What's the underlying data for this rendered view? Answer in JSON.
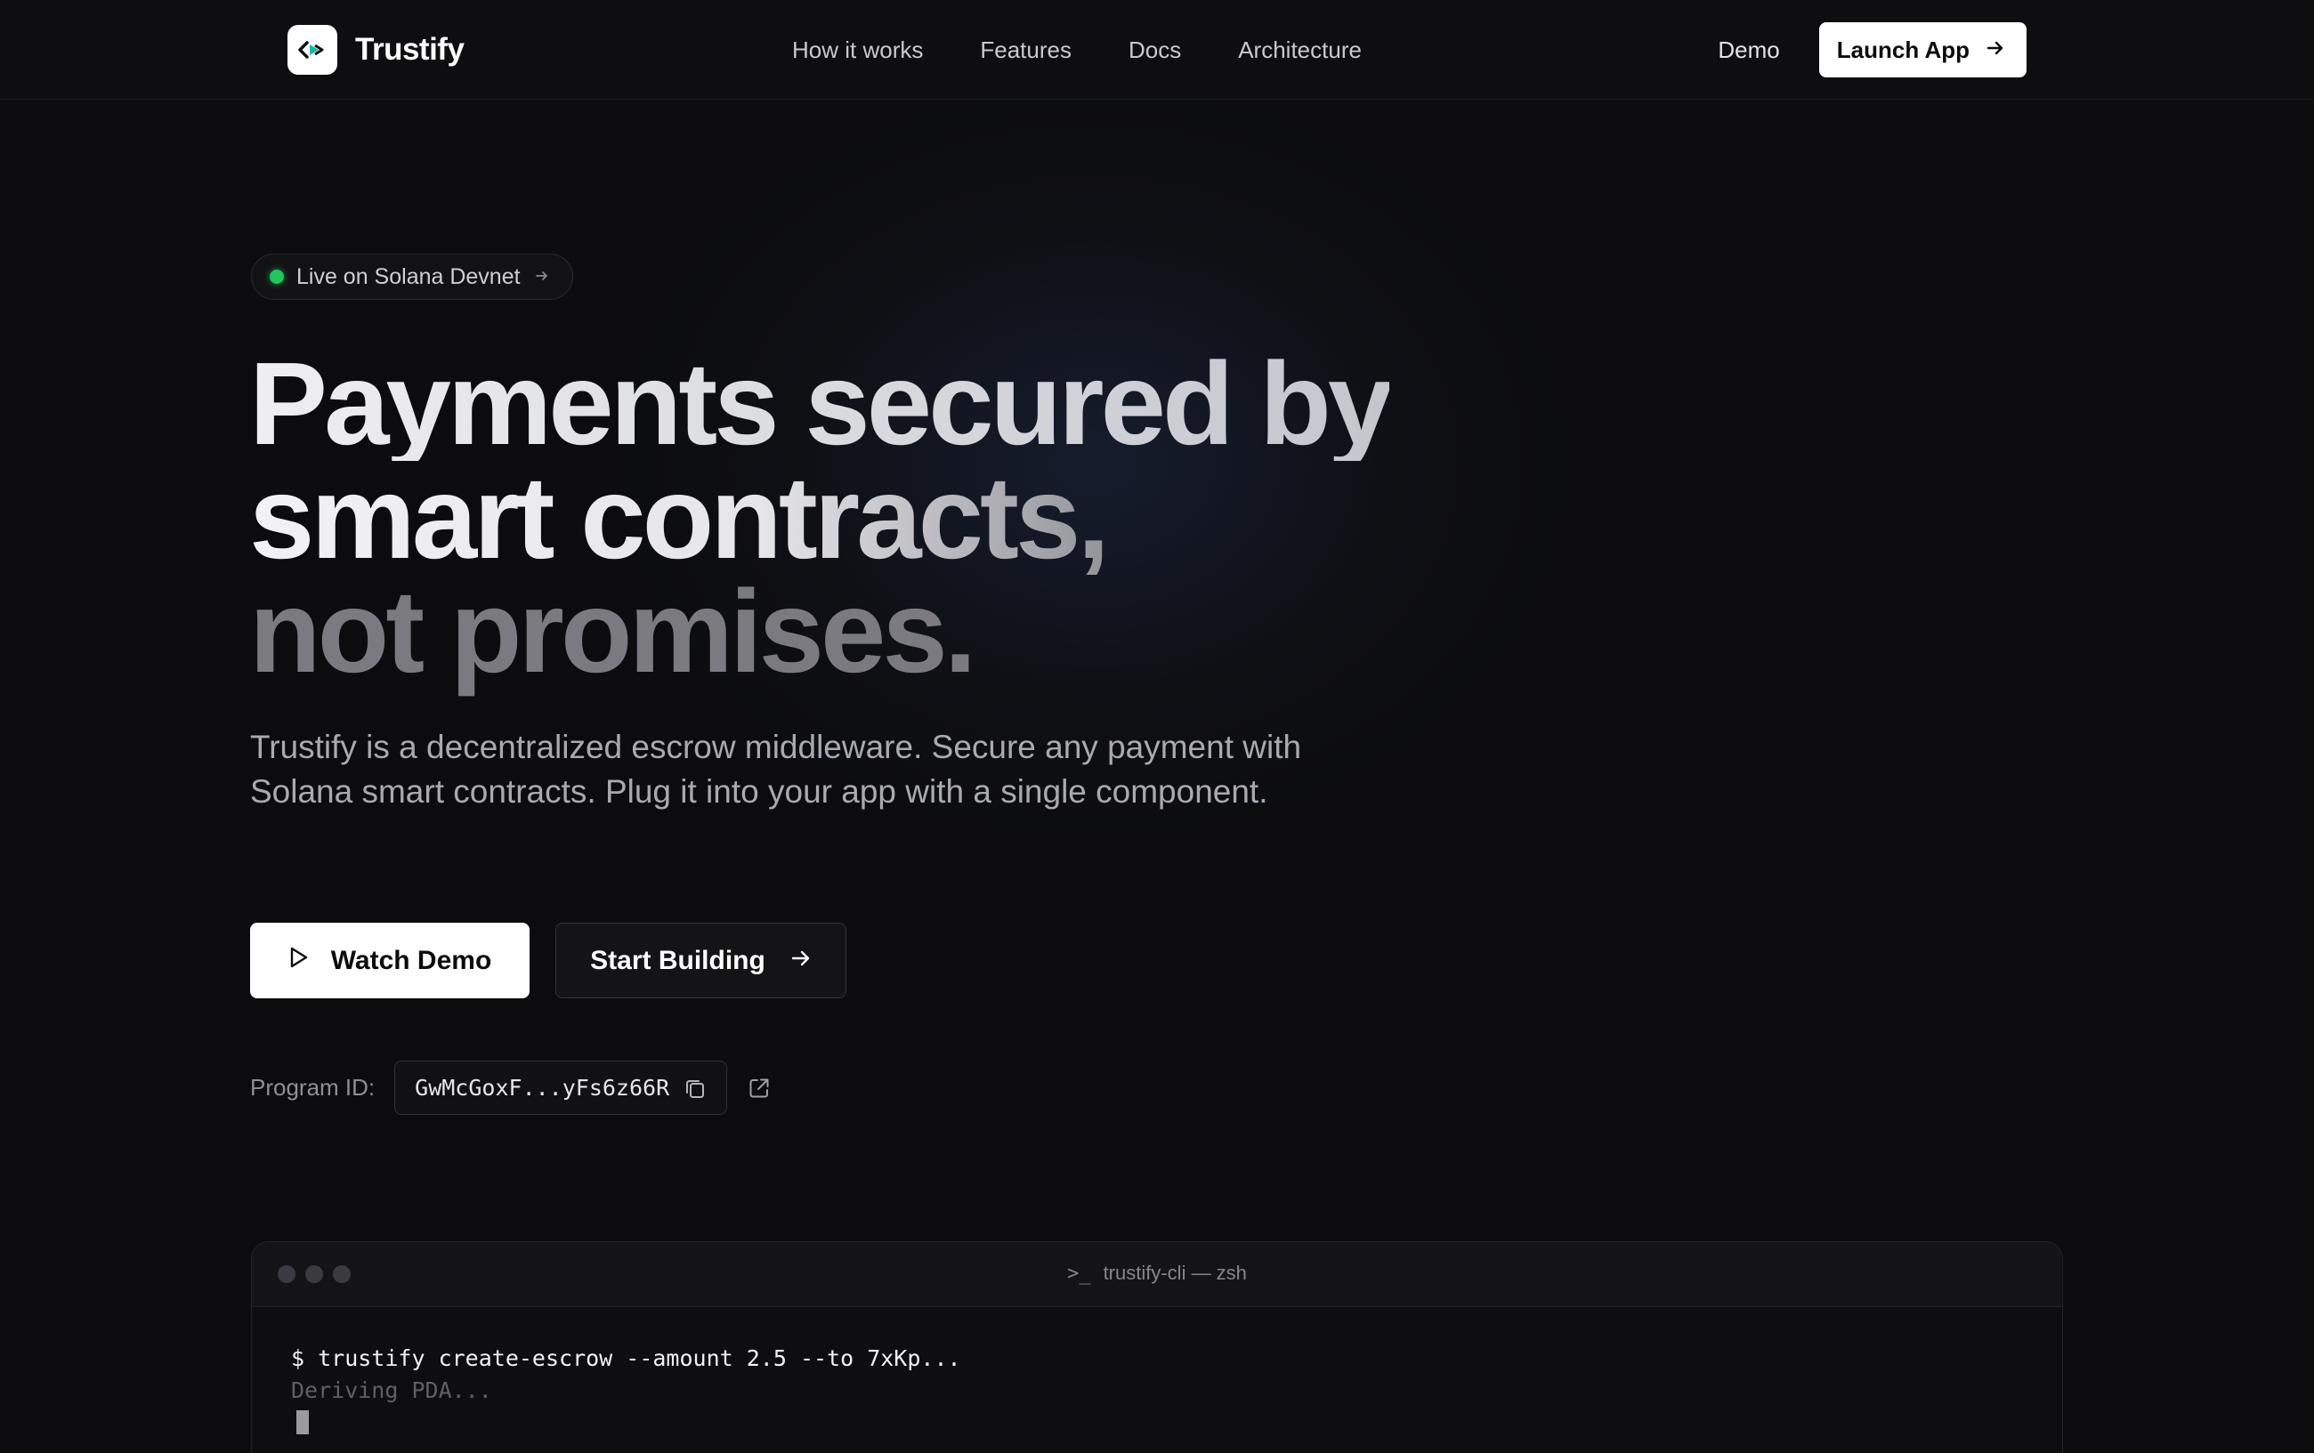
{
  "navbar": {
    "brand": "Trustify",
    "links": [
      "How it works",
      "Features",
      "Docs",
      "Architecture"
    ],
    "demo": "Demo",
    "launch": "Launch App"
  },
  "hero": {
    "badge": "Live on Solana Devnet",
    "headline": {
      "line1": "Payments secured by",
      "line2": "smart contracts,",
      "line3": "not promises."
    },
    "subtext": "Trustify is a decentralized escrow middleware. Secure any payment with Solana smart contracts. Plug it into your app with a single component.",
    "watch_demo": "Watch Demo",
    "start_building": "Start Building",
    "program_label": "Program ID:",
    "program_id": "GwMcGoxF...yFs6z66R"
  },
  "terminal": {
    "title": "trustify-cli — zsh",
    "command": "$ trustify create-escrow --amount 2.5 --to 7xKp...",
    "output": "Deriving PDA..."
  },
  "colors": {
    "background": "#0c0c0e",
    "accent": "#ffffff",
    "status_live": "#22c55e",
    "brand_teal": "#14b8a6"
  },
  "icons": {
    "logo": "trustify-logo-icon",
    "launch_arrow": "arrow-right-icon",
    "badge_arrow": "arrow-right-icon",
    "watch": "play-icon",
    "build_arrow": "arrow-right-icon",
    "copy": "copy-icon",
    "external": "external-link-icon",
    "terminal": "terminal-prompt-icon"
  }
}
